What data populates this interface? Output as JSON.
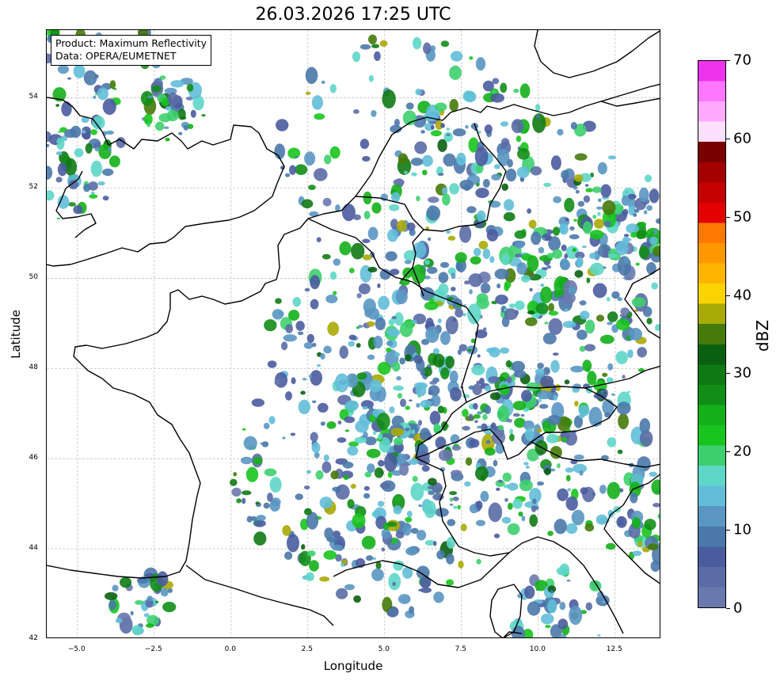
{
  "title": "26.03.2026 17:25 UTC",
  "info": {
    "product": "Product: Maximum Reflectivity",
    "source": "Data: OPERA/EUMETNET"
  },
  "axes": {
    "xlabel": "Longitude",
    "ylabel": "Latitude",
    "xlim": [
      -6,
      14
    ],
    "ylim": [
      42,
      55.5
    ],
    "xticks": [
      "−5.0",
      "−2.5",
      "0.0",
      "2.5",
      "5.0",
      "7.5",
      "10.0",
      "12.5"
    ],
    "xtick_values": [
      -5,
      -2.5,
      0,
      2.5,
      5,
      7.5,
      10,
      12.5
    ],
    "yticks": [
      "42",
      "44",
      "46",
      "48",
      "50",
      "52",
      "54"
    ],
    "ytick_values": [
      42,
      44,
      46,
      48,
      50,
      52,
      54
    ],
    "grid": true
  },
  "colorbar": {
    "label": "dBZ",
    "ticks": [
      "0",
      "10",
      "20",
      "30",
      "40",
      "50",
      "60",
      "70"
    ],
    "tick_values": [
      0,
      10,
      20,
      30,
      40,
      50,
      60,
      70
    ],
    "range": [
      0,
      70
    ],
    "colors": [
      "#6a79ad",
      "#5a6ba5",
      "#4a5c9e",
      "#4a78aa",
      "#5a96c2",
      "#62bed8",
      "#5ed6c8",
      "#3ecf6e",
      "#18c41e",
      "#14b01a",
      "#128e16",
      "#0f7a14",
      "#0a5f10",
      "#467a0a",
      "#a8aa06",
      "#fad400",
      "#ffb400",
      "#ff9800",
      "#ff7800",
      "#e40000",
      "#c40000",
      "#a40000",
      "#7a0000",
      "#fde0fd",
      "#ffaaff",
      "#ff77ff",
      "#ee33ee"
    ]
  },
  "chart_data": {
    "type": "heatmap",
    "title": "26.03.2026 17:25 UTC",
    "xlabel": "Longitude",
    "ylabel": "Latitude",
    "xlim": [
      -6,
      14
    ],
    "ylim": [
      42,
      55.5
    ],
    "colorbar_label": "dBZ",
    "colorbar_range": [
      0,
      70
    ]
  }
}
